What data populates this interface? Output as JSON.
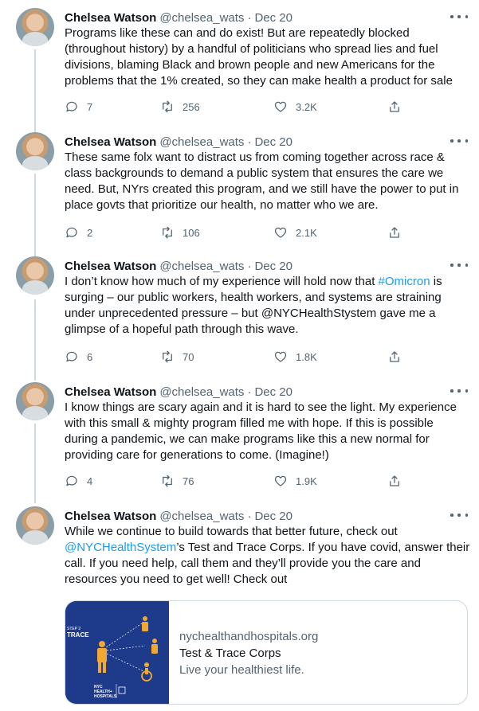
{
  "tweets": [
    {
      "name": "Chelsea Watson",
      "handle": "@chelsea_wats",
      "separator": "·",
      "date": "Dec 20",
      "lines": [
        "Programs like these can and do exist! But are repeatedly blocked",
        "(throughout history) by a handful of politicians who spread lies and fuel",
        "divisions, blaming Black and brown people and new Americans for the",
        "problems that the 1% created, so they can make health a product for sale"
      ],
      "replies": "7",
      "retweets": "256",
      "likes": "3.2K"
    },
    {
      "name": "Chelsea Watson",
      "handle": "@chelsea_wats",
      "separator": "·",
      "date": "Dec 20",
      "lines": [
        "These same folx want to distract us from coming together across race &",
        "class backgrounds to demand a public system that ensures the care we",
        "need. But, NYrs created this program, and we still have the power to put in",
        "place govts that prioritize our health, no matter who we are."
      ],
      "replies": "2",
      "retweets": "106",
      "likes": "2.1K"
    },
    {
      "name": "Chelsea Watson",
      "handle": "@chelsea_wats",
      "separator": "·",
      "date": "Dec 20",
      "line1_pre": "I don’t know how much of my experience will hold now that ",
      "hashtag": "#Omicron",
      "line1_post": " is",
      "lines": [
        "surging – our public workers, health workers, and systems are straining",
        "under unprecedented pressure – but @NYCHealthStystem gave me a",
        "glimpse of a hopeful path through this wave."
      ],
      "replies": "6",
      "retweets": "70",
      "likes": "1.8K"
    },
    {
      "name": "Chelsea Watson",
      "handle": "@chelsea_wats",
      "separator": "·",
      "date": "Dec 20",
      "lines": [
        "I know things are scary again and it is hard to see the light. My experience",
        "with this small & mighty program filled me with hope. If this is possible",
        "during a pandemic, we can make programs like this a new normal for",
        "providing care for generations to come. (Imagine!)"
      ],
      "replies": "4",
      "retweets": "76",
      "likes": "1.9K"
    },
    {
      "name": "Chelsea Watson",
      "handle": "@chelsea_wats",
      "separator": "·",
      "date": "Dec 20",
      "line0": "While we continue to build towards that better future, check out",
      "mention": "@NYCHealthSystem",
      "line1_post": "’s Test and Trace Corps. If you have covid, answer their",
      "lines": [
        "call. If you need help, call them and they’ll provide you the care and",
        "resources you need to get well! Check out"
      ],
      "card": {
        "domain": "nychealthandhospitals.org",
        "title": "Test & Trace Corps",
        "description": "Live your healthiest life.",
        "image_step": "STEP 2",
        "image_heading": "TRACE",
        "image_logo_line1": "NYC",
        "image_logo_line2": "HEALTH+",
        "image_logo_line3": "HOSPITALS"
      }
    }
  ],
  "icons": {
    "reply": "reply-icon",
    "retweet": "retweet-icon",
    "like": "heart-icon",
    "share": "share-icon",
    "more": "more-icon"
  },
  "colors": {
    "link": "#1d9bf0",
    "secondary": "#536471",
    "thread_line": "#cfd9de",
    "card_image_bg": "#1e3a8a",
    "card_figure": "#f0a830"
  }
}
